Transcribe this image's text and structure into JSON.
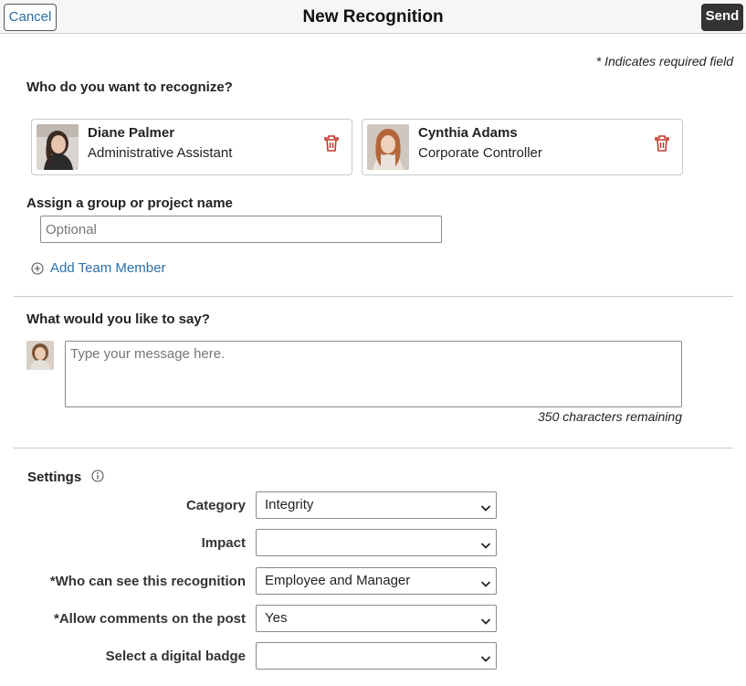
{
  "header": {
    "cancel_label": "Cancel",
    "title": "New Recognition",
    "send_label": "Send"
  },
  "required_note": "* Indicates required field",
  "recipients": {
    "heading": "Who do you want to recognize?",
    "people": [
      {
        "name": "Diane Palmer",
        "title": "Administrative Assistant"
      },
      {
        "name": "Cynthia Adams",
        "title": "Corporate Controller"
      }
    ]
  },
  "group": {
    "label": "Assign a group or project name",
    "placeholder": "Optional",
    "value": ""
  },
  "add_member_label": "Add Team Member",
  "message": {
    "heading": "What would you like to say?",
    "placeholder": "Type your message here.",
    "value": "",
    "chars_remaining": "350 characters remaining"
  },
  "settings": {
    "heading": "Settings",
    "fields": [
      {
        "label": "Category",
        "value": "Integrity"
      },
      {
        "label": "Impact",
        "value": ""
      },
      {
        "label": "*Who can see this recognition",
        "value": "Employee and Manager"
      },
      {
        "label": "*Allow comments on the post",
        "value": "Yes"
      },
      {
        "label": "Select a digital badge",
        "value": ""
      }
    ]
  },
  "colors": {
    "link": "#2a6ea8",
    "delete": "#c0392b",
    "send_bg": "#333333",
    "header_bg": "#f4f6f7"
  }
}
